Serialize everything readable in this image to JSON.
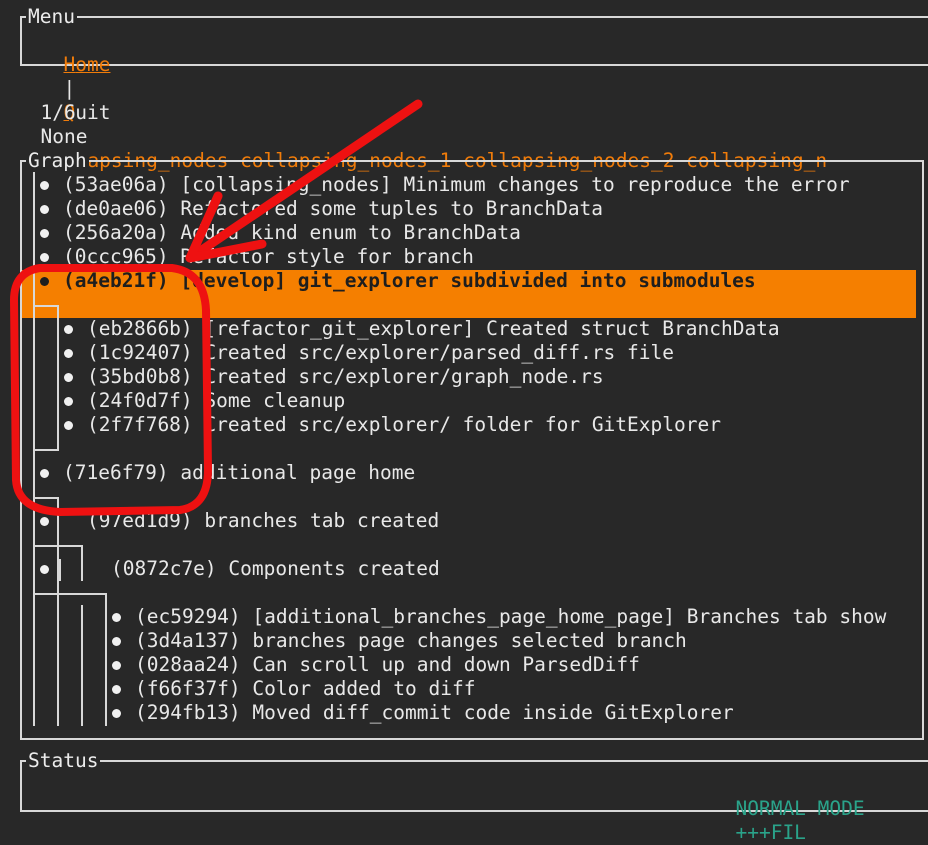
{
  "menu": {
    "title": "Menu",
    "items": [
      {
        "hotkey": "H",
        "rest": "ome"
      },
      {
        "hotkey": "Q",
        "rest": "uit"
      }
    ],
    "separator": "|"
  },
  "tabs": {
    "position": "1/6",
    "current": "None",
    "branches_text": "collapsing_nodes collapsing_nodes_1 collapsing_nodes_2 collapsing_n"
  },
  "graph": {
    "title": "Graph",
    "commits": [
      {
        "text": "(53ae06a) [collapsing_nodes] Minimum changes to reproduce the error"
      },
      {
        "text": "(de0ae06) Refactored some tuples to BranchData"
      },
      {
        "text": "(256a20a) Added kind enum to BranchData"
      },
      {
        "text": "(0ccc965) Refactor style for branch"
      },
      {
        "text": "(a4eb21f) [develop] git_explorer subdivided into submodules",
        "selected": true
      },
      {
        "text": "(eb2866b) [refactor_git_explorer] Created struct BranchData"
      },
      {
        "text": "(1c92407) Created src/explorer/parsed_diff.rs file"
      },
      {
        "text": "(35bd0b8) Created src/explorer/graph_node.rs"
      },
      {
        "text": "(24f0d7f) Some cleanup"
      },
      {
        "text": "(2f7f768) Created src/explorer/ folder for GitExplorer"
      },
      {
        "text": "(71e6f79) additional page home"
      },
      {
        "text": "(97ed1d9) branches tab created"
      },
      {
        "text": "(0872c7e) Components created"
      },
      {
        "text": "(ec59294) [additional_branches_page_home_page] Branches tab show"
      },
      {
        "text": "(3d4a137) branches page changes selected branch"
      },
      {
        "text": "(028aa24) Can scroll up and down ParsedDiff"
      },
      {
        "text": "(f66f37f) Color added to diff"
      },
      {
        "text": "(294fb13) Moved diff_commit code inside GitExplorer"
      }
    ]
  },
  "status": {
    "title": "Status",
    "mode": "NORMAL MODE",
    "extra": "+++FIL"
  },
  "colors": {
    "accent": "#f57f00",
    "status": "#2aa38a",
    "annotation": "#ee1111"
  }
}
